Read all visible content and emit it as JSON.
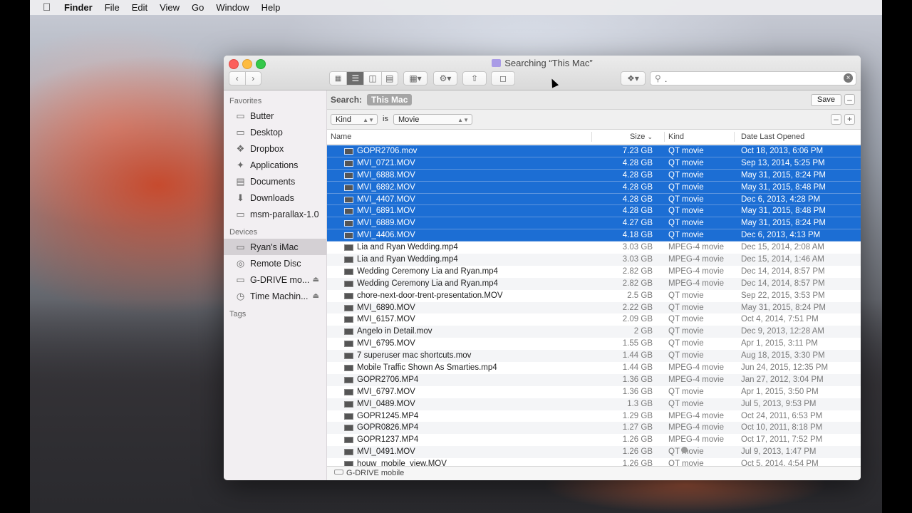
{
  "menubar": {
    "items": [
      "Finder",
      "File",
      "Edit",
      "View",
      "Go",
      "Window",
      "Help"
    ]
  },
  "window": {
    "title": "Searching “This Mac”",
    "search_value": "."
  },
  "toolbar": {
    "view_icons": [
      "icon-view-icon",
      "list-view-icon",
      "column-view-icon",
      "coverflow-view-icon"
    ],
    "active_view": "list"
  },
  "sidebar": {
    "favorites_header": "Favorites",
    "favorites": [
      {
        "label": "Butter",
        "icon": "folder-icon"
      },
      {
        "label": "Desktop",
        "icon": "desktop-folder-icon"
      },
      {
        "label": "Dropbox",
        "icon": "dropbox-icon"
      },
      {
        "label": "Applications",
        "icon": "applications-icon"
      },
      {
        "label": "Documents",
        "icon": "documents-icon"
      },
      {
        "label": "Downloads",
        "icon": "downloads-icon"
      },
      {
        "label": "msm-parallax-1.0",
        "icon": "folder-icon"
      }
    ],
    "devices_header": "Devices",
    "devices": [
      {
        "label": "Ryan's iMac",
        "icon": "imac-icon",
        "selected": true
      },
      {
        "label": "Remote Disc",
        "icon": "disc-icon"
      },
      {
        "label": "G-DRIVE mo...",
        "icon": "drive-icon",
        "eject": true
      },
      {
        "label": "Time Machin...",
        "icon": "time-machine-icon",
        "eject": true
      }
    ],
    "tags_header": "Tags"
  },
  "scope": {
    "label": "Search:",
    "chip": "This Mac",
    "save": "Save"
  },
  "criteria": {
    "attribute": "Kind",
    "operator": "is",
    "value": "Movie"
  },
  "columns": {
    "name": "Name",
    "size": "Size",
    "kind": "Kind",
    "date": "Date Last Opened"
  },
  "files": [
    {
      "name": "GOPR2706.mov",
      "size": "7.23 GB",
      "kind": "QT movie",
      "date": "Oct 18, 2013, 6:06 PM",
      "selected": true
    },
    {
      "name": "MVI_0721.MOV",
      "size": "4.28 GB",
      "kind": "QT movie",
      "date": "Sep 13, 2014, 5:25 PM",
      "selected": true
    },
    {
      "name": "MVI_6888.MOV",
      "size": "4.28 GB",
      "kind": "QT movie",
      "date": "May 31, 2015, 8:24 PM",
      "selected": true
    },
    {
      "name": "MVI_6892.MOV",
      "size": "4.28 GB",
      "kind": "QT movie",
      "date": "May 31, 2015, 8:48 PM",
      "selected": true
    },
    {
      "name": "MVI_4407.MOV",
      "size": "4.28 GB",
      "kind": "QT movie",
      "date": "Dec 6, 2013, 4:28 PM",
      "selected": true
    },
    {
      "name": "MVI_6891.MOV",
      "size": "4.28 GB",
      "kind": "QT movie",
      "date": "May 31, 2015, 8:48 PM",
      "selected": true
    },
    {
      "name": "MVI_6889.MOV",
      "size": "4.27 GB",
      "kind": "QT movie",
      "date": "May 31, 2015, 8:24 PM",
      "selected": true
    },
    {
      "name": "MVI_4406.MOV",
      "size": "4.18 GB",
      "kind": "QT movie",
      "date": "Dec 6, 2013, 4:13 PM",
      "selected": true
    },
    {
      "name": "Lia and Ryan Wedding.mp4",
      "size": "3.03 GB",
      "kind": "MPEG-4 movie",
      "date": "Dec 15, 2014, 2:08 AM"
    },
    {
      "name": "Lia and Ryan Wedding.mp4",
      "size": "3.03 GB",
      "kind": "MPEG-4 movie",
      "date": "Dec 15, 2014, 1:46 AM"
    },
    {
      "name": "Wedding Ceremony Lia and Ryan.mp4",
      "size": "2.82 GB",
      "kind": "MPEG-4 movie",
      "date": "Dec 14, 2014, 8:57 PM"
    },
    {
      "name": "Wedding Ceremony Lia and Ryan.mp4",
      "size": "2.82 GB",
      "kind": "MPEG-4 movie",
      "date": "Dec 14, 2014, 8:57 PM"
    },
    {
      "name": "chore-next-door-trent-presentation.MOV",
      "size": "2.5 GB",
      "kind": "QT movie",
      "date": "Sep 22, 2015, 3:53 PM"
    },
    {
      "name": "MVI_6890.MOV",
      "size": "2.22 GB",
      "kind": "QT movie",
      "date": "May 31, 2015, 8:24 PM"
    },
    {
      "name": "MVI_6157.MOV",
      "size": "2.09 GB",
      "kind": "QT movie",
      "date": "Oct 4, 2014, 7:51 PM"
    },
    {
      "name": "Angelo in Detail.mov",
      "size": "2 GB",
      "kind": "QT movie",
      "date": "Dec 9, 2013, 12:28 AM"
    },
    {
      "name": "MVI_6795.MOV",
      "size": "1.55 GB",
      "kind": "QT movie",
      "date": "Apr 1, 2015, 3:11 PM"
    },
    {
      "name": "7 superuser mac shortcuts.mov",
      "size": "1.44 GB",
      "kind": "QT movie",
      "date": "Aug 18, 2015, 3:30 PM"
    },
    {
      "name": "Mobile Traffic Shown As Smarties.mp4",
      "size": "1.44 GB",
      "kind": "MPEG-4 movie",
      "date": "Jun 24, 2015, 12:35 PM"
    },
    {
      "name": "GOPR2706.MP4",
      "size": "1.36 GB",
      "kind": "MPEG-4 movie",
      "date": "Jan 27, 2012, 3:04 PM"
    },
    {
      "name": "MVI_6797.MOV",
      "size": "1.36 GB",
      "kind": "QT movie",
      "date": "Apr 1, 2015, 3:50 PM"
    },
    {
      "name": "MVI_0489.MOV",
      "size": "1.3 GB",
      "kind": "QT movie",
      "date": "Jul 5, 2013, 9:53 PM"
    },
    {
      "name": "GOPR1245.MP4",
      "size": "1.29 GB",
      "kind": "MPEG-4 movie",
      "date": "Oct 24, 2011, 6:53 PM"
    },
    {
      "name": "GOPR0826.MP4",
      "size": "1.27 GB",
      "kind": "MPEG-4 movie",
      "date": "Oct 10, 2011, 8:18 PM"
    },
    {
      "name": "GOPR1237.MP4",
      "size": "1.26 GB",
      "kind": "MPEG-4 movie",
      "date": "Oct 17, 2011, 7:52 PM"
    },
    {
      "name": "MVI_0491.MOV",
      "size": "1.26 GB",
      "kind": "QT movie",
      "date": "Jul 9, 2013, 1:47 PM"
    },
    {
      "name": "houw_mobile_view.MOV",
      "size": "1.26 GB",
      "kind": "QT movie",
      "date": "Oct 5, 2014, 4:54 PM"
    }
  ],
  "pathbar": {
    "label": "G-DRIVE mobile"
  },
  "colors": {
    "selection": "#1c6ed4",
    "sidebar_bg": "#f2eff2"
  }
}
